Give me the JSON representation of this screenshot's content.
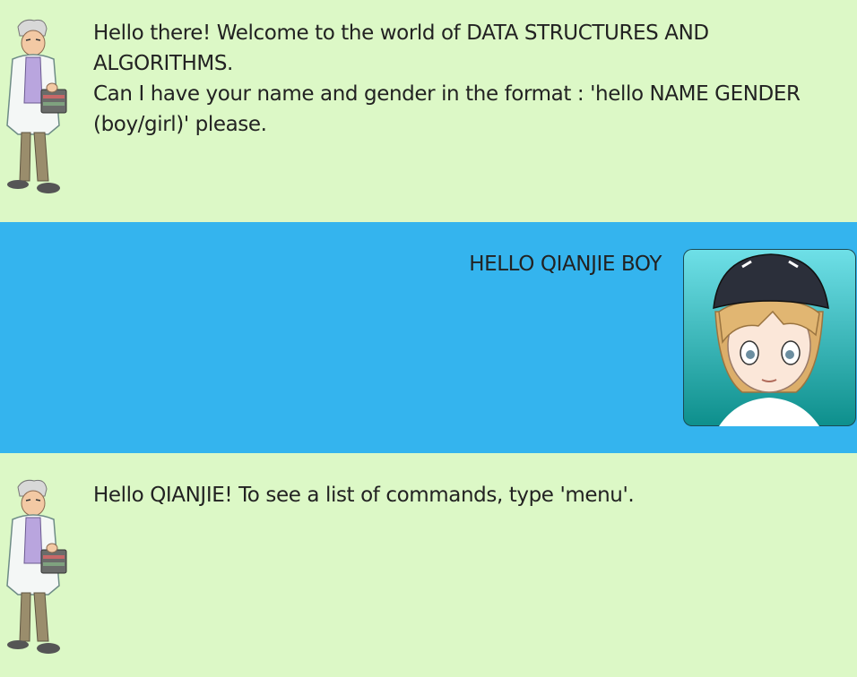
{
  "messages": [
    {
      "sender": "bot",
      "text": "Hello there! Welcome to the world of DATA STRUCTURES AND ALGORITHMS.\nCan I have your name and gender in the format : 'hello NAME GENDER (boy/girl)' please."
    },
    {
      "sender": "user",
      "text": "HELLO QIANJIE BOY"
    },
    {
      "sender": "bot",
      "text": "Hello QIANJIE! To see a list of commands, type 'menu'."
    }
  ],
  "colors": {
    "bot_bubble": "#dcf8c6",
    "user_bubble": "#34b4ee",
    "text": "#222222"
  },
  "icons": {
    "bot_avatar": "professor-avatar-icon",
    "user_avatar": "trainer-avatar-icon"
  }
}
